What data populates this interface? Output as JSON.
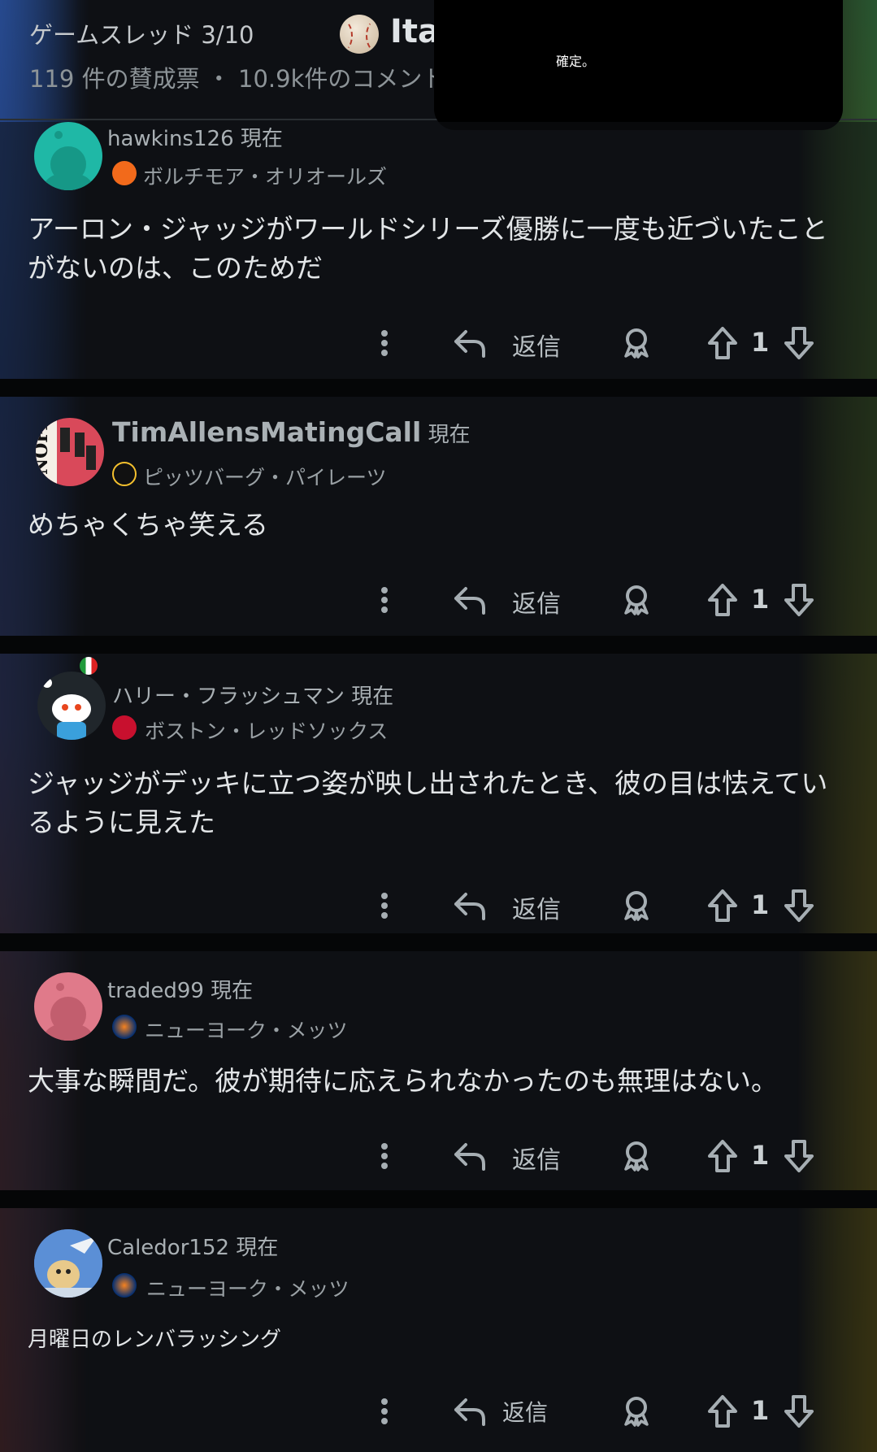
{
  "header": {
    "thread_label": "ゲームスレッド 3/10",
    "thread_title": "Ita",
    "stats": "119 件の賛成票 ・ 10.9k件のコメント"
  },
  "toast": {
    "text": "確定。"
  },
  "comments": [
    {
      "username": "hawkins126",
      "time": "現在",
      "flair": "ボルチモア・オリオールズ",
      "body": "アーロン・ジャッジがワールドシリーズ優勝に一度も近づいたことがないのは、このためだ",
      "reply_label": "返信",
      "score": "1",
      "avatar_color": "#1fb8a6"
    },
    {
      "username": "TimAllensMatingCall",
      "time": "現在",
      "flair": "ピッツバーグ・パイレーツ",
      "body": "めちゃくちゃ笑える",
      "reply_label": "返信",
      "score": "1",
      "avatar_color": "#d9495a"
    },
    {
      "username": "ハリー・フラッシュマン",
      "time": "現在",
      "flair": "ボストン・レッドソックス",
      "body": "ジャッジがデッキに立つ姿が映し出されたとき、彼の目は怯えているように見えた",
      "reply_label": "返信",
      "score": "1",
      "avatar_color": "#20262b"
    },
    {
      "username": "traded99",
      "time": "現在",
      "flair": "ニューヨーク・メッツ",
      "body": "大事な瞬間だ。彼が期待に応えられなかったのも無理はない。",
      "reply_label": "返信",
      "score": "1",
      "avatar_color": "#e07a8a"
    },
    {
      "username": "Caledor152",
      "time": "現在",
      "flair": "ニューヨーク・メッツ",
      "body": "月曜日のレンバラッシング",
      "reply_label": "返信",
      "score": "1",
      "avatar_color": "#4b78c8"
    }
  ]
}
